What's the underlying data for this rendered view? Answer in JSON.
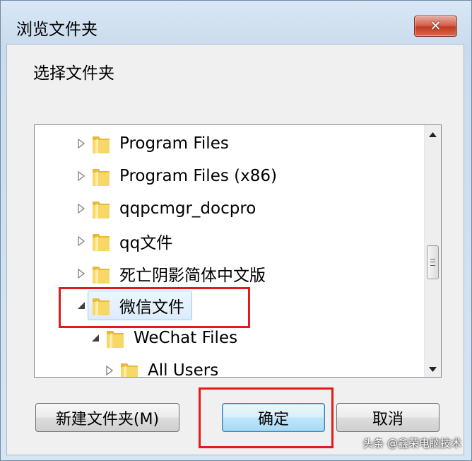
{
  "window": {
    "title": "浏览文件夹",
    "close_glyph": "✕"
  },
  "instruction": "选择文件夹",
  "tree": {
    "items": [
      {
        "label": "Program Files",
        "expander": "collapsed",
        "level": 1
      },
      {
        "label": "Program Files (x86)",
        "expander": "collapsed",
        "level": 1
      },
      {
        "label": "qqpcmgr_docpro",
        "expander": "collapsed",
        "level": 1
      },
      {
        "label": "qq文件",
        "expander": "collapsed",
        "level": 1
      },
      {
        "label": "死亡阴影简体中文版",
        "expander": "collapsed",
        "level": 1
      },
      {
        "label": "微信文件",
        "expander": "expanded",
        "level": 1,
        "selected": true
      },
      {
        "label": "WeChat Files",
        "expander": "expanded",
        "level": 2
      },
      {
        "label": "All Users",
        "expander": "collapsed",
        "level": 3
      }
    ]
  },
  "buttons": {
    "new_folder": "新建文件夹(M)",
    "ok": "确定",
    "cancel": "取消"
  },
  "watermark": "头条 @鑫荣电脑技术",
  "colors": {
    "highlight_box": "#e11b1b",
    "selection_fill": "#dcebfc",
    "folder_yellow": "#f2c94c"
  },
  "icons": {
    "folder": "folder-icon",
    "expander_collapsed": "triangle-right-icon",
    "expander_expanded": "triangle-down-right-icon",
    "close": "close-icon"
  }
}
